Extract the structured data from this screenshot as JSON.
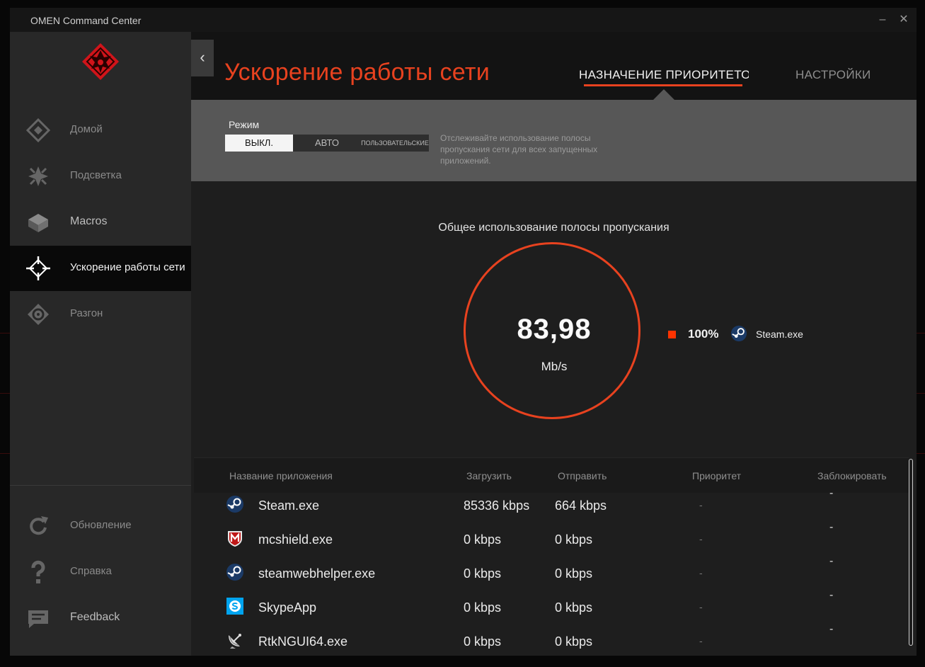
{
  "window": {
    "title": "OMEN Command Center",
    "minimize_glyph": "–",
    "close_glyph": "✕"
  },
  "sidebar": {
    "collapse_glyph": "‹",
    "items": [
      {
        "label": "Домой",
        "icon": "home-diamond-icon"
      },
      {
        "label": "Подсветка",
        "icon": "lighting-icon"
      },
      {
        "label": "Macros",
        "icon": "macros-keycap-icon"
      },
      {
        "label": "Ускорение работы сети",
        "icon": "network-booster-icon",
        "active": true
      },
      {
        "label": "Разгон",
        "icon": "overclock-gauge-icon"
      }
    ],
    "bottom_items": [
      {
        "label": "Обновление",
        "icon": "update-refresh-icon"
      },
      {
        "label": "Справка",
        "icon": "help-question-icon"
      },
      {
        "label": "Feedback",
        "icon": "feedback-chat-icon"
      }
    ]
  },
  "header": {
    "title": "Ускорение работы сети",
    "tabs": [
      {
        "label": "НАЗНАЧЕНИЕ ПРИОРИТЕТОВ",
        "active": true
      },
      {
        "label": "НАСТРОЙКИ",
        "active": false
      }
    ]
  },
  "mode": {
    "label": "Режим",
    "options": [
      "ВЫКЛ.",
      "АВТО",
      "ПОЛЬЗОВАТЕЛЬСКИЕ"
    ],
    "selected": "ВЫКЛ.",
    "description": "Отслеживайте использование полосы пропускания сети для всех запущенных приложений."
  },
  "bandwidth": {
    "title": "Общее использование полосы пропускания",
    "value": "83,98",
    "unit": "Mb/s",
    "legend": [
      {
        "percent": "100%",
        "app": "Steam.exe",
        "color": "#ff3300",
        "icon": "steam-icon"
      }
    ]
  },
  "table": {
    "columns": [
      "Название приложения",
      "Загрузить",
      "Отправить",
      "Приоритет",
      "Заблокировать"
    ],
    "rows": [
      {
        "name": "Steam.exe",
        "icon": "steam-icon",
        "download": "85336 kbps",
        "upload": "664 kbps",
        "priority": "-",
        "block": "-"
      },
      {
        "name": "mcshield.exe",
        "icon": "mcafee-icon",
        "download": "0 kbps",
        "upload": "0 kbps",
        "priority": "-",
        "block": "-"
      },
      {
        "name": "steamwebhelper.exe",
        "icon": "steam-icon",
        "download": "0 kbps",
        "upload": "0 kbps",
        "priority": "-",
        "block": "-"
      },
      {
        "name": "SkypeApp",
        "icon": "skype-icon",
        "download": "0 kbps",
        "upload": "0 kbps",
        "priority": "-",
        "block": "-"
      },
      {
        "name": "RtkNGUI64.exe",
        "icon": "realtek-satellite-icon",
        "download": "0 kbps",
        "upload": "0 kbps",
        "priority": "-",
        "block": "-"
      }
    ]
  },
  "colors": {
    "accent": "#e8421f",
    "legend_swatch": "#ff3300",
    "sidebar_bg": "#282828",
    "active_nav_bg": "#090909",
    "mode_panel_bg": "#575757"
  }
}
